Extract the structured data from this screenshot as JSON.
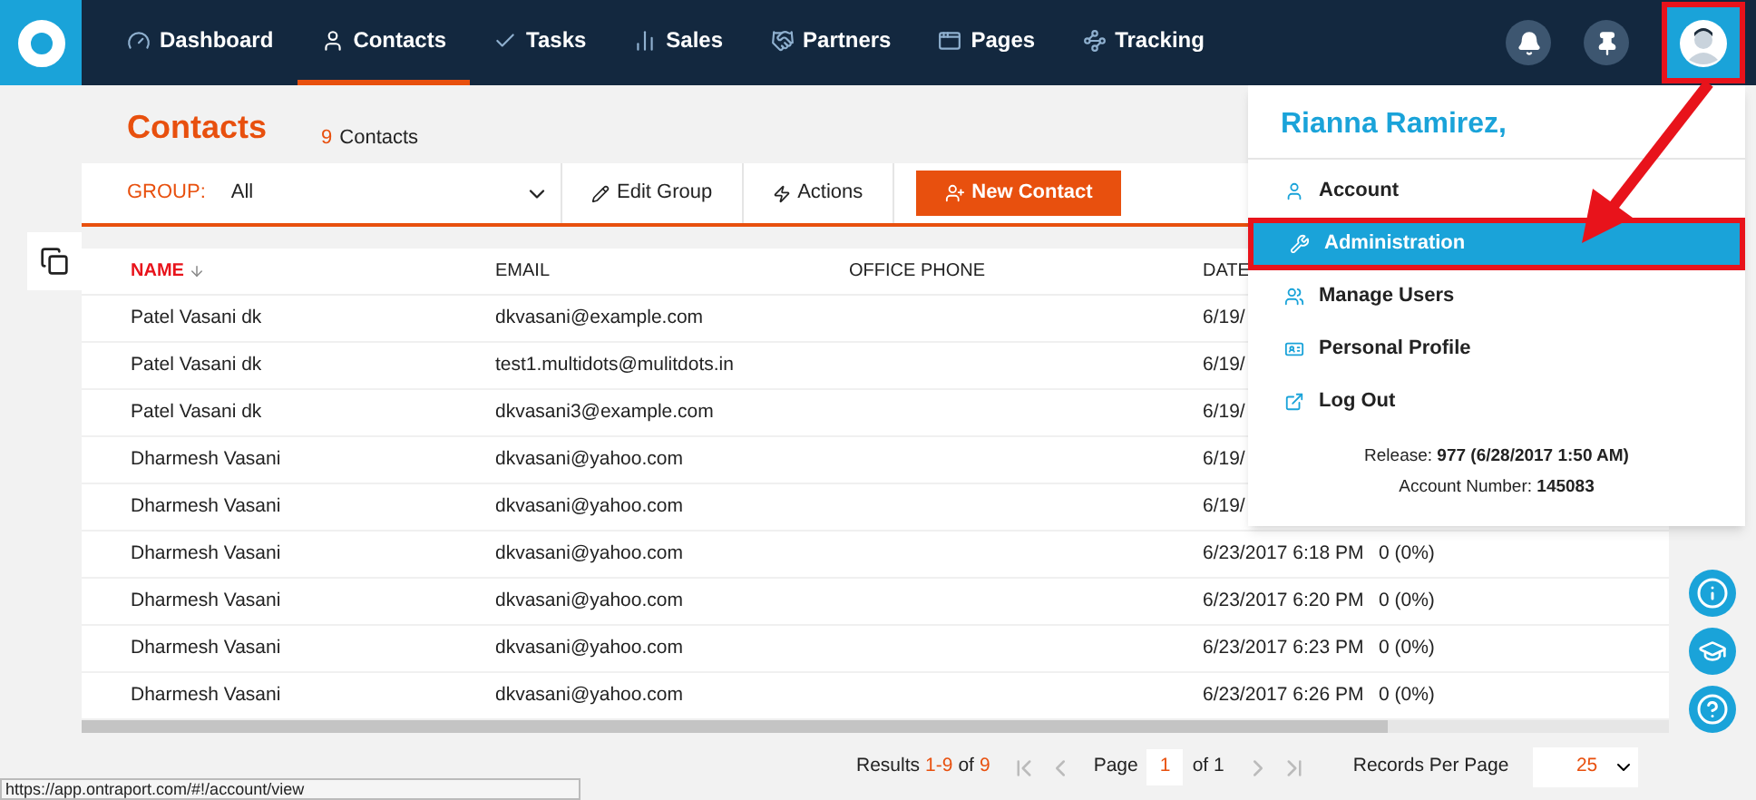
{
  "nav": {
    "items": [
      {
        "label": "Dashboard",
        "selected": false
      },
      {
        "label": "Contacts",
        "selected": true
      },
      {
        "label": "Tasks",
        "selected": false
      },
      {
        "label": "Sales",
        "selected": false
      },
      {
        "label": "Partners",
        "selected": false
      },
      {
        "label": "Pages",
        "selected": false
      },
      {
        "label": "Tracking",
        "selected": false
      }
    ]
  },
  "page": {
    "title": "Contacts",
    "count": "9",
    "count_label": "Contacts"
  },
  "toolbar": {
    "group_label": "GROUP:",
    "group_value": "All",
    "edit_group": "Edit Group",
    "actions": "Actions",
    "new_contact": "New Contact"
  },
  "table": {
    "columns": [
      {
        "label": "NAME",
        "sorted": true
      },
      {
        "label": "EMAIL",
        "sorted": false
      },
      {
        "label": "OFFICE PHONE",
        "sorted": false
      },
      {
        "label": "DATE",
        "sorted": false
      }
    ],
    "rows": [
      {
        "name": "Patel Vasani dk",
        "email": "dkvasani@example.com",
        "date": "6/19/"
      },
      {
        "name": "Patel Vasani dk",
        "email": "test1.multidots@mulitdots.in",
        "date": "6/19/"
      },
      {
        "name": "Patel Vasani dk",
        "email": "dkvasani3@example.com",
        "date": "6/19/"
      },
      {
        "name": "Dharmesh Vasani",
        "email": "dkvasani@yahoo.com",
        "date": "6/19/"
      },
      {
        "name": "Dharmesh Vasani",
        "email": "dkvasani@yahoo.com",
        "date": "6/19/"
      },
      {
        "name": "Dharmesh Vasani",
        "email": "dkvasani@yahoo.com",
        "date": "6/23/2017 6:18 PM",
        "count": "0 (0%)"
      },
      {
        "name": "Dharmesh Vasani",
        "email": "dkvasani@yahoo.com",
        "date": "6/23/2017 6:20 PM",
        "count": "0 (0%)"
      },
      {
        "name": "Dharmesh Vasani",
        "email": "dkvasani@yahoo.com",
        "date": "6/23/2017 6:23 PM",
        "count": "0 (0%)"
      },
      {
        "name": "Dharmesh Vasani",
        "email": "dkvasani@yahoo.com",
        "date": "6/23/2017 6:26 PM",
        "count": "0 (0%)"
      }
    ]
  },
  "footer": {
    "results_label": "Results",
    "results_range": "1-9",
    "results_of": "of",
    "results_total": "9",
    "page_label": "Page",
    "page_value": "1",
    "page_of": "of 1",
    "per_page_label": "Records Per Page",
    "per_page_value": "25"
  },
  "status_url": "https://app.ontraport.com/#!/account/view",
  "user_menu": {
    "name": "Rianna Ramirez,",
    "items": [
      {
        "label": "Account",
        "selected": false
      },
      {
        "label": "Administration",
        "selected": true
      },
      {
        "label": "Manage Users",
        "selected": false
      },
      {
        "label": "Personal Profile",
        "selected": false
      },
      {
        "label": "Log Out",
        "selected": false
      }
    ],
    "release_label": "Release:",
    "release_value": "977 (6/28/2017 1:50 AM)",
    "account_label": "Account Number:",
    "account_value": "145083"
  }
}
